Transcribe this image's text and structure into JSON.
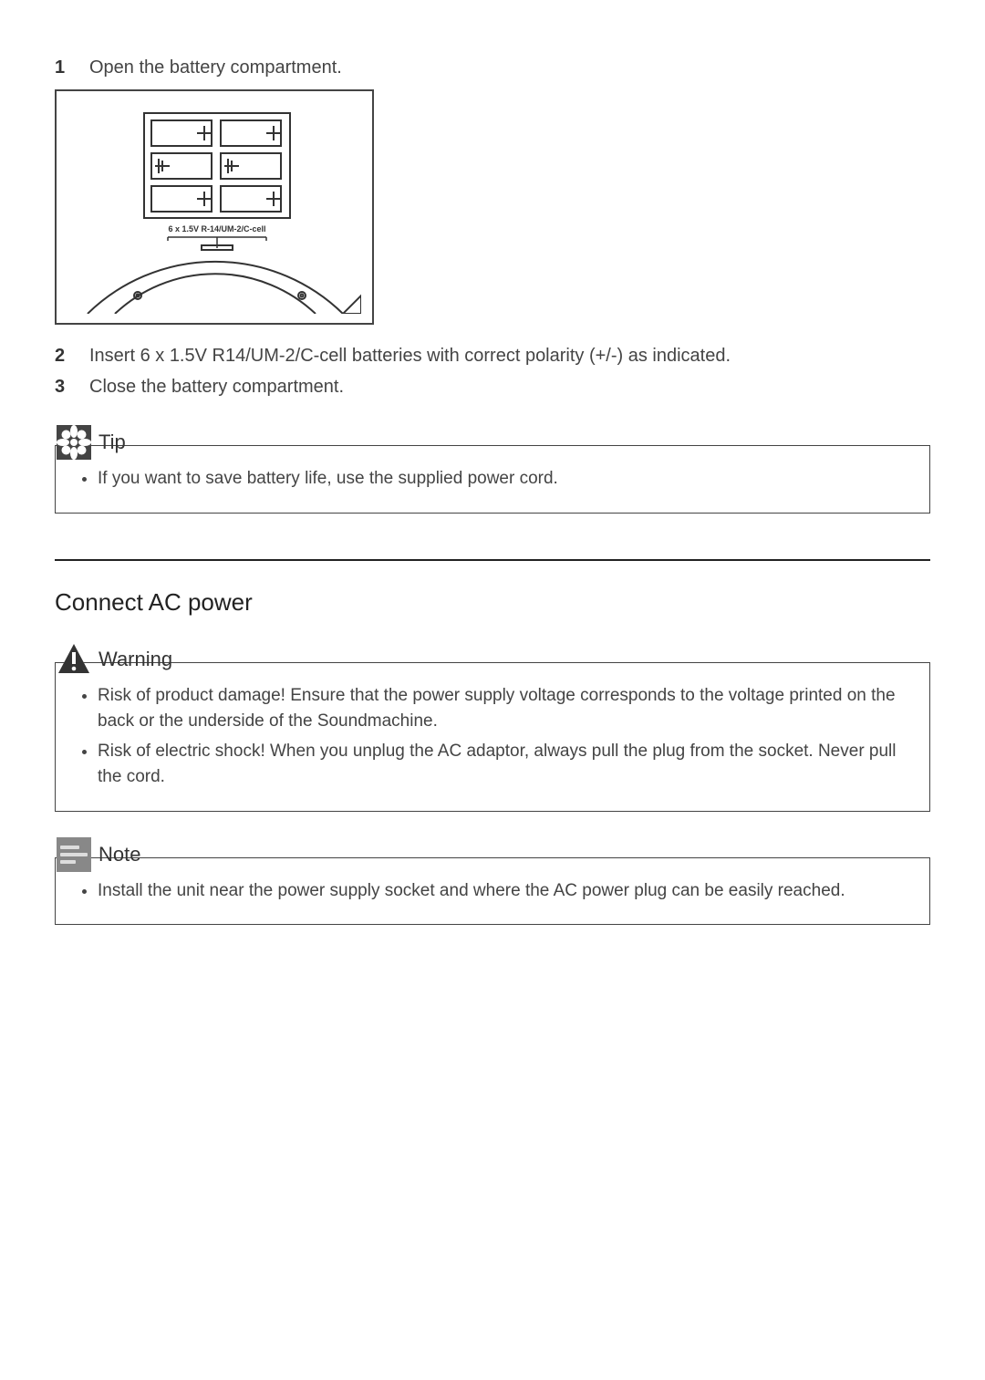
{
  "steps_a": [
    {
      "num": "1",
      "text": "Open the battery compartment."
    }
  ],
  "diagram_caption": "6 x 1.5V R-14/UM-2/C-cell",
  "steps_b": [
    {
      "num": "2",
      "text": "Insert 6 x 1.5V R14/UM-2/C-cell batteries with correct polarity (+/-) as indicated."
    },
    {
      "num": "3",
      "text": "Close the battery compartment."
    }
  ],
  "tip": {
    "title": "Tip",
    "items": [
      "If you want to save battery life, use the supplied power cord."
    ]
  },
  "section2_title": "Connect AC power",
  "warning": {
    "title": "Warning",
    "items": [
      "Risk of product damage! Ensure that the power supply voltage corresponds to the voltage printed on the back or the underside of the Soundmachine.",
      "Risk of electric shock! When you unplug the AC adaptor, always pull the plug from the socket. Never pull the cord."
    ]
  },
  "note": {
    "title": "Note",
    "items": [
      "Install the unit near the power supply socket and where the AC power plug can be easily reached."
    ]
  }
}
